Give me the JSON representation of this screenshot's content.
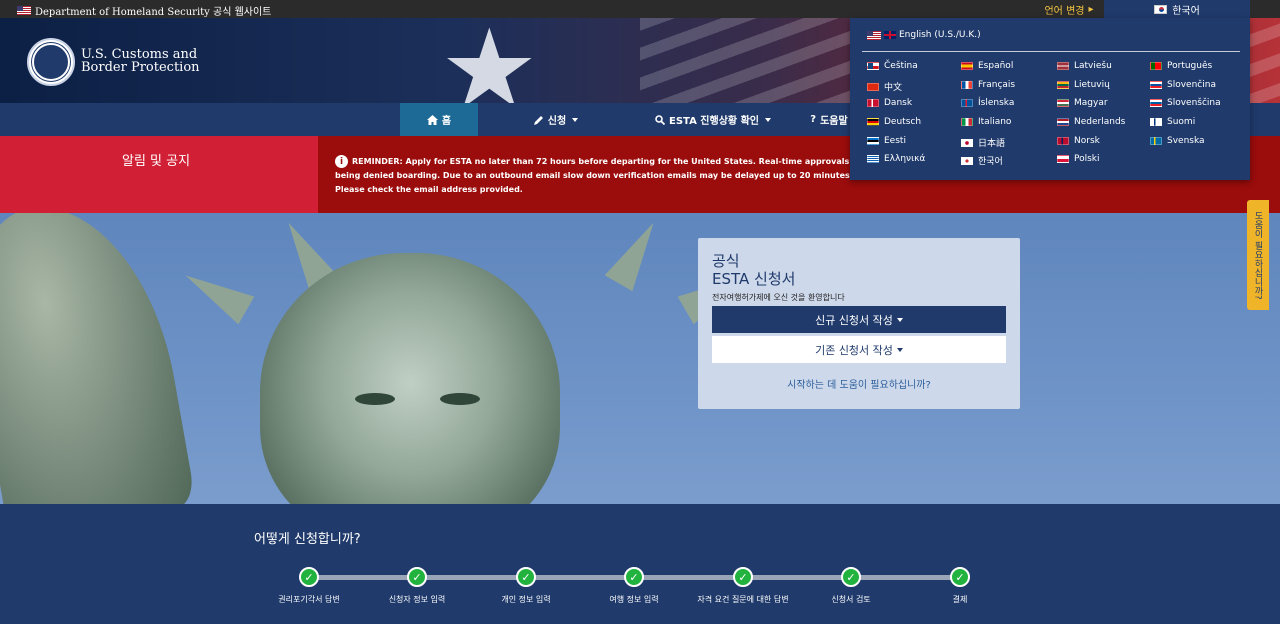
{
  "topbar": {
    "gov_text": "Department of Homeland Security 공식 웹사이트",
    "change_language": "언어 변경",
    "current_language": "한국어"
  },
  "header": {
    "agency_line1": "U.S. Customs and",
    "agency_line2": "Border Protection"
  },
  "nav": {
    "home": "홈",
    "apply": "신청",
    "status": "ESTA 진행상황 확인",
    "help": "도움말"
  },
  "notice": {
    "title": "알림 및 공지",
    "message": "REMINDER: Apply for ESTA no later than 72 hours before departing for the United States. Real-time approvals will no longer be guaranteed. Travelers who do not have an approved ESTA risk being denied boarding. Due to an outbound email slow down verification emails may be delayed up to 20 minutes. The validity of the code provided in the email has been extended accordingly. Please check the email address provided."
  },
  "app_card": {
    "title_line1": "공식",
    "title_line2": "ESTA 신청서",
    "subtitle": "전자여행허가제에 오신 것을 환영합니다",
    "new_button": "신규 신청서 작성",
    "existing_button": "기존 신청서 작성",
    "help_link": "시작하는 데 도움이 필요하십니까?"
  },
  "side_help": "도움이 필요하십니까?",
  "steps": {
    "heading": "어떻게 신청합니까?",
    "items": [
      {
        "label": "권리포기각서 답변",
        "check": "✓"
      },
      {
        "label": "신청자 정보 입력",
        "check": "✓"
      },
      {
        "label": "개인 정보 입력",
        "check": "✓"
      },
      {
        "label": "여행 정보 입력",
        "check": "✓"
      },
      {
        "label": "자격 요건 질문에 대한 답변",
        "check": "✓"
      },
      {
        "label": "신청서 검토",
        "check": "✓"
      },
      {
        "label": "결제",
        "check": "✓"
      }
    ]
  },
  "language_menu": {
    "english": "English (U.S./U.K.)",
    "col1": [
      "Čeština",
      "中文",
      "Dansk",
      "Deutsch",
      "Eesti",
      "Ελληνικά"
    ],
    "col2": [
      "Español",
      "Français",
      "Íslenska",
      "Italiano",
      "日本語",
      "한국어"
    ],
    "col3": [
      "Latviešu",
      "Lietuvių",
      "Magyar",
      "Nederlands",
      "Norsk",
      "Polski"
    ],
    "col4": [
      "Português",
      "Slovenčina",
      "Slovenščina",
      "Suomi",
      "Svenska"
    ]
  },
  "colors": {
    "navy": "#1f3a6b",
    "notice_red": "#d11f35",
    "notice_dark_red": "#9b0c0c",
    "step_green": "#22b33f",
    "help_tab_yellow": "#f0b429"
  }
}
